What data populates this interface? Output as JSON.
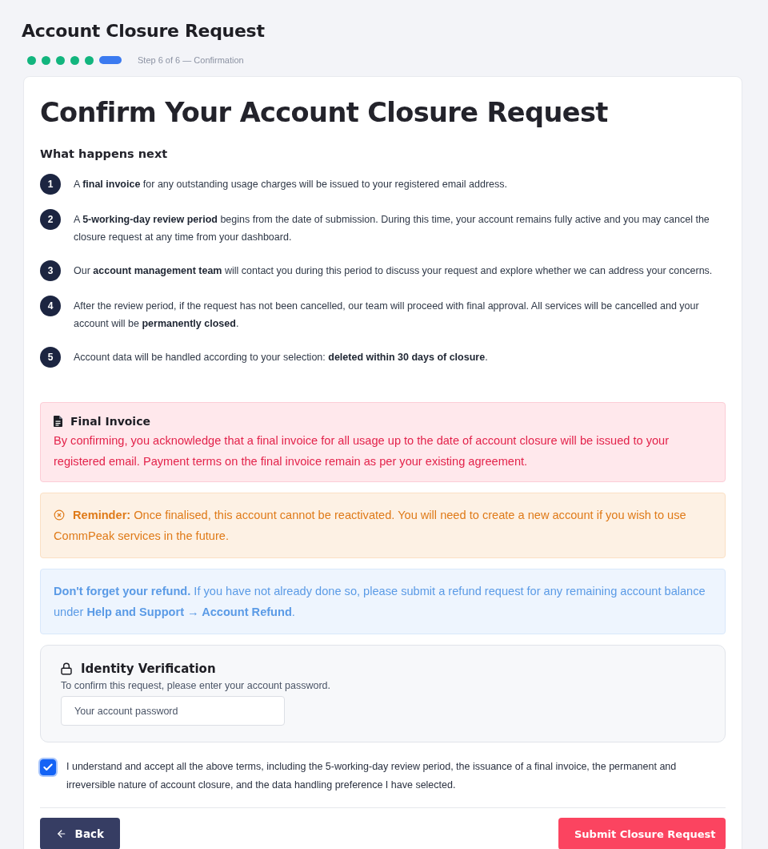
{
  "header": {
    "title": "Account Closure Request",
    "stepper": {
      "steps": [
        {
          "selected": false
        },
        {
          "selected": false
        },
        {
          "selected": false
        },
        {
          "selected": false
        },
        {
          "selected": false
        },
        {
          "selected": true
        }
      ],
      "label": "Step 6 of 6 — Confirmation"
    }
  },
  "card": {
    "heading": "Confirm Your Account Closure Request",
    "next_steps": {
      "title": "What happens next",
      "items": [
        {
          "number": "1",
          "text": "A **final invoice** for any outstanding usage charges will be issued to your registered email address."
        },
        {
          "number": "2",
          "text": "A **5-working-day review period** begins from the date of submission. During this time, your account remains fully active and you may cancel the closure request at any time from your dashboard."
        },
        {
          "number": "3",
          "text": "Our **account management team** will contact you during this period to discuss your request and explore whether we can address your concerns."
        },
        {
          "number": "4",
          "text": "After the review period, if the request has not been cancelled, our team will proceed with final approval. All services will be cancelled and your account will be **permanently closed**."
        },
        {
          "number": "5",
          "text": "Account data will be handled according to your selection: **deleted within 30 days of closure**."
        }
      ]
    },
    "notices": [
      {
        "kind": "invoice",
        "title": "Final Invoice",
        "text": "By confirming, you acknowledge that a final invoice for all usage up to the date of account closure will be issued to your registered email. Payment terms on the final invoice remain as per your existing agreement."
      },
      {
        "kind": "reminder",
        "text": "**Reminder:** Once finalised, this account cannot be reactivated. You will need to create a new account if you wish to use CommPeak services in the future."
      },
      {
        "kind": "refund",
        "text": "**Don't forget your refund.** If you have not already done so, please submit a refund request for any remaining account balance under **Help and Support → Account Refund**."
      }
    ],
    "verification": {
      "title": "Identity Verification",
      "hint": "To confirm this request, please enter your account password.",
      "password": {
        "placeholder": "Your account password"
      }
    },
    "consent": {
      "checked": true,
      "text": "I understand and accept all the above terms, including the 5-working-day review period, the issuance of a final invoice, the permanent and irreversible nature of account closure, and the data handling preference I have selected."
    },
    "actions": {
      "back": "Back",
      "submit": "Submit Closure Request"
    }
  }
}
